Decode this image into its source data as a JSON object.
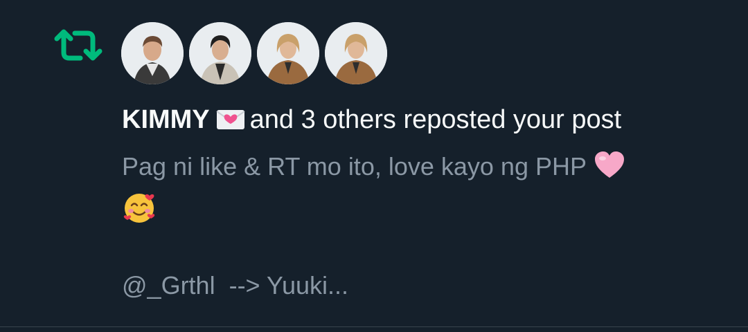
{
  "notification": {
    "type_icon": "repost-icon",
    "accent_color": "#00ba7c",
    "avatars": [
      {
        "name": "avatar-1"
      },
      {
        "name": "avatar-2"
      },
      {
        "name": "avatar-3"
      },
      {
        "name": "avatar-4"
      }
    ],
    "user_name": "KIMMY",
    "name_emoji_icon": "love-letter-icon",
    "action_text": "and 3 others reposted your post",
    "post_text": "Pag ni like & RT mo ito, love kayo ng PHP",
    "post_emojis": [
      "pink-heart-icon",
      "smiling-face-with-hearts-icon"
    ],
    "post_continuation": "@_Grthl  --> Yuuki..."
  },
  "colors": {
    "background": "#15202b",
    "primary_text": "#f7f9f9",
    "secondary_text": "#8b98a5",
    "divider": "#38444d"
  }
}
